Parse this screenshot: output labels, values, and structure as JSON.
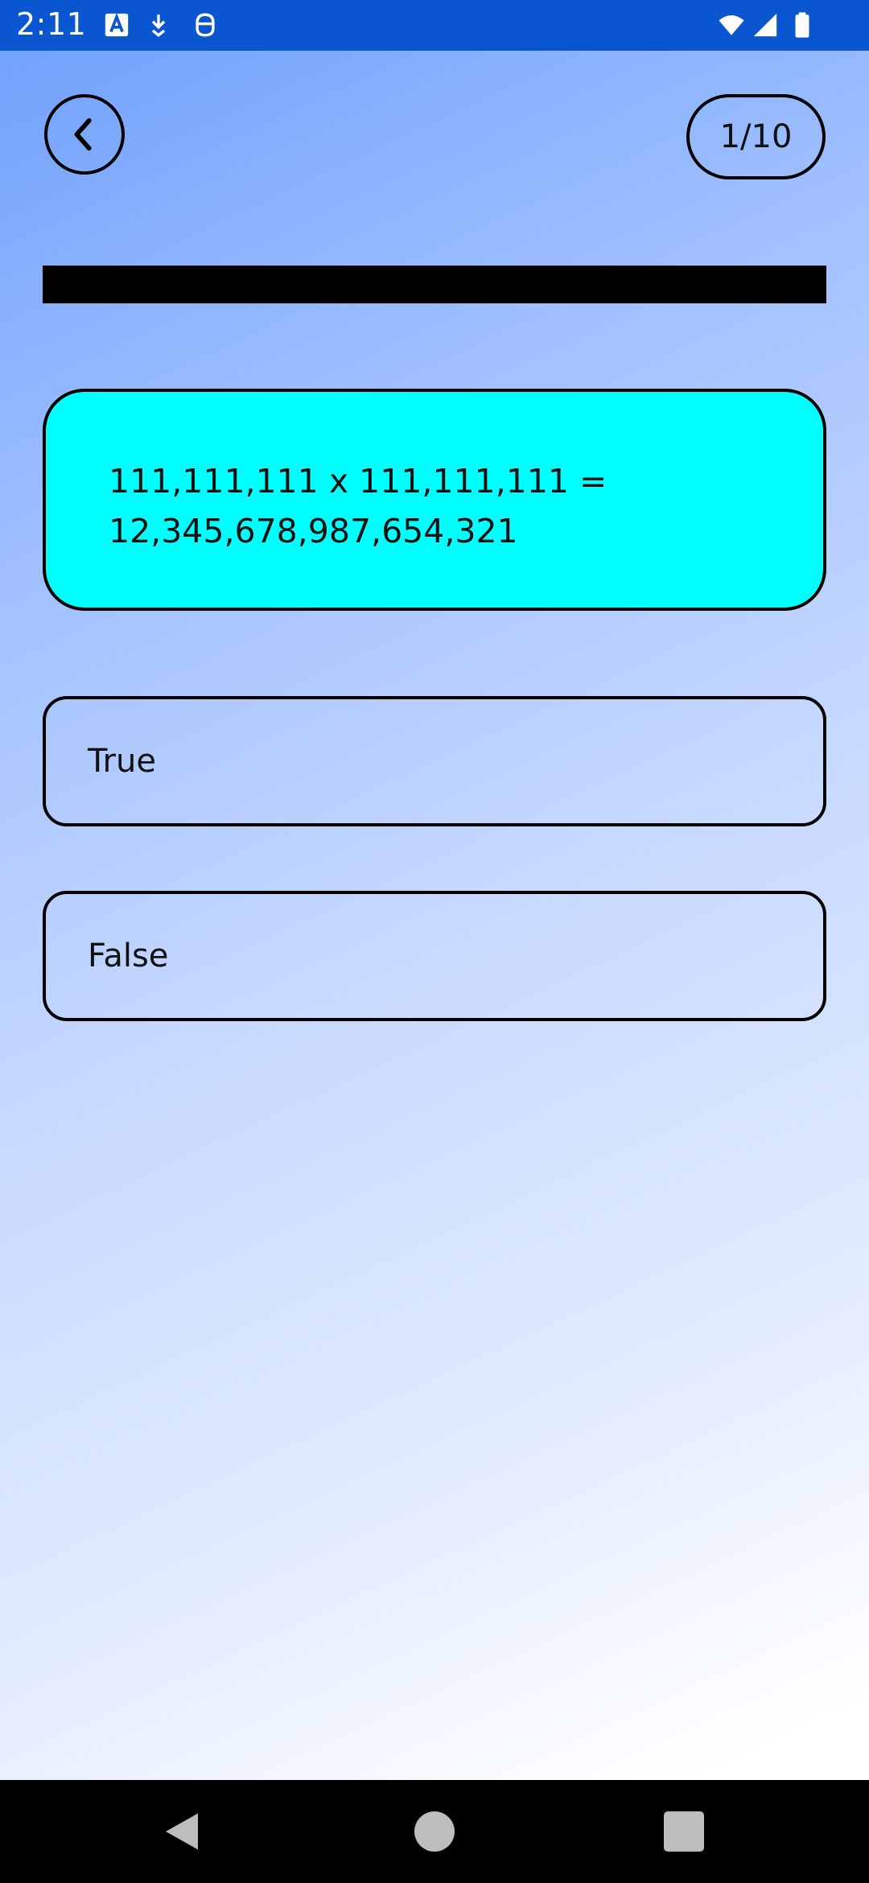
{
  "status_bar": {
    "time": "2:11",
    "icons": [
      "accessibility-a-icon",
      "download-icon",
      "android-icon",
      "wifi-icon",
      "signal-icon",
      "battery-icon"
    ]
  },
  "header": {
    "back_icon": "chevron-left-icon",
    "counter": "1/10"
  },
  "progress": {
    "fraction": 1.0,
    "color": "#000000"
  },
  "question": {
    "text": "111,111,111 x 111,111,111 =\n12,345,678,987,654,321",
    "background": "#00ffff"
  },
  "answers": [
    {
      "label": "True"
    },
    {
      "label": "False"
    }
  ],
  "nav_bar": {
    "icons": [
      "back-triangle-icon",
      "home-circle-icon",
      "recents-square-icon"
    ]
  }
}
